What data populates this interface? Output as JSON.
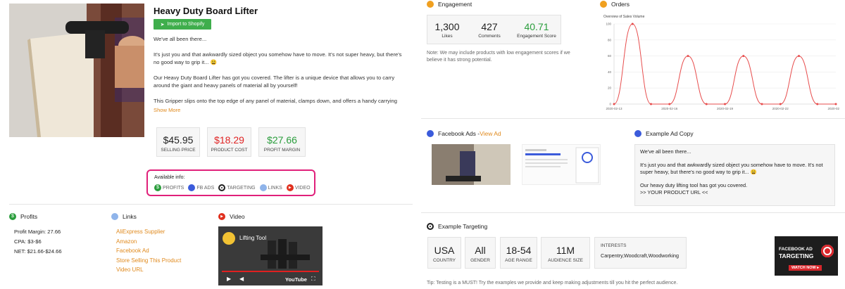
{
  "product": {
    "title": "Heavy Duty Board Lifter",
    "import_button": "Import to Shopify",
    "desc_p1": "We've all been there...",
    "desc_p2": "It's just you and that awkwardly sized object you somehow have to move. It's not super heavy, but there's no good way to grip it... 😩",
    "desc_p3": "Our Heavy Duty Board Lifter has got you covered. The lifter is a unique device that allows you to carry around the giant and heavy panels of material all by yourself!",
    "desc_p4": "This Gripper slips onto the top edge of any panel of material, clamps down, and offers a handy carrying",
    "show_more": "Show More"
  },
  "prices": [
    {
      "value": "$45.95",
      "label": "SELLING PRICE",
      "color": "#222222"
    },
    {
      "value": "$18.29",
      "label": "PRODUCT COST",
      "color": "#e02424"
    },
    {
      "value": "$27.66",
      "label": "PROFIT MARGIN",
      "color": "#2a9d3c"
    }
  ],
  "available_info": {
    "title": "Available info:",
    "items": [
      {
        "label": "PROFITS",
        "icon": "dollar-icon",
        "color": "#2a9d3c"
      },
      {
        "label": "FB ADS",
        "icon": "facebook-icon",
        "color": "#3b5bdb"
      },
      {
        "label": "TARGETING",
        "icon": "target-icon",
        "color": "#222222"
      },
      {
        "label": "LINKS",
        "icon": "globe-icon",
        "color": "#5b8fd8"
      },
      {
        "label": "VIDEO",
        "icon": "play-icon",
        "color": "#e0301e"
      }
    ],
    "border_color": "#e0207a"
  },
  "profits": {
    "title": "Profits",
    "margin": "Profit Margin: 27.66",
    "cpa": "CPA: $3-$6",
    "net": "NET: $21.66-$24.66"
  },
  "links": {
    "title": "Links",
    "items": [
      "AliExpress Supplier",
      "Amazon",
      "Facebook Ad",
      "Store Selling This Product",
      "Video URL"
    ]
  },
  "video": {
    "title": "Video",
    "caption": "Lifting Tool",
    "brand": "YouTube"
  },
  "engagement": {
    "title": "Engagement",
    "likes": "1,300",
    "likes_label": "Likes",
    "comments": "427",
    "comments_label": "Comments",
    "score": "40.71",
    "score_label": "Engagement Score",
    "note": "Note: We may include products with low engagement scores if we believe it has strong potential."
  },
  "orders": {
    "title": "Orders",
    "chart_title": "Overview of Sales Volume"
  },
  "chart_data": {
    "type": "line",
    "title": "Overview of Sales Volume",
    "x": [
      "2020-02-13",
      "2020-02-14",
      "2020-02-15",
      "2020-02-16",
      "2020-02-17",
      "2020-02-18",
      "2020-02-19",
      "2020-02-20",
      "2020-02-21",
      "2020-02-22",
      "2020-02-23",
      "2020-02-24",
      "2020-02-25"
    ],
    "x_ticks": [
      "2020-02-13",
      "2020-02-16",
      "2020-02-19",
      "2020-02-22",
      "2020-02-25"
    ],
    "series": [
      {
        "values": [
          0,
          100,
          0,
          0,
          60,
          0,
          0,
          60,
          0,
          0,
          60,
          0,
          0
        ]
      }
    ],
    "ylim": [
      0,
      100
    ],
    "y_ticks": [
      0,
      20,
      40,
      60,
      80,
      100
    ],
    "grid": true,
    "color": "#e74c4c"
  },
  "fb_ads": {
    "title": "Facebook Ads -",
    "view_ad": "View Ad"
  },
  "ad_copy": {
    "title": "Example Ad Copy",
    "p1": "We've all been there...",
    "p2": "It's just you and that awkwardly sized object you somehow have to move. It's not super heavy, but there's no good way to grip it... 😩",
    "p3": "Our heavy duty lifting tool has got you covered.",
    "p4": ">> YOUR PRODUCT URL <<"
  },
  "targeting": {
    "title": "Example Targeting",
    "boxes": [
      {
        "value": "USA",
        "label": "COUNTRY"
      },
      {
        "value": "All",
        "label": "GENDER"
      },
      {
        "value": "18-54",
        "label": "AGE RANGE"
      },
      {
        "value": "11M",
        "label": "AUDIENCE SIZE"
      }
    ],
    "interests_label": "INTERESTS",
    "interests": "Carpentry,Woodcraft,Woodworking",
    "tip": "Tip: Testing is a MUST! Try the examples we provide and keep making adjustments till you hit the perfect audience.",
    "promo_line1": "FACEBOOK AD",
    "promo_line2": "TARGETING",
    "promo_cta": "WATCH NOW ▸"
  }
}
